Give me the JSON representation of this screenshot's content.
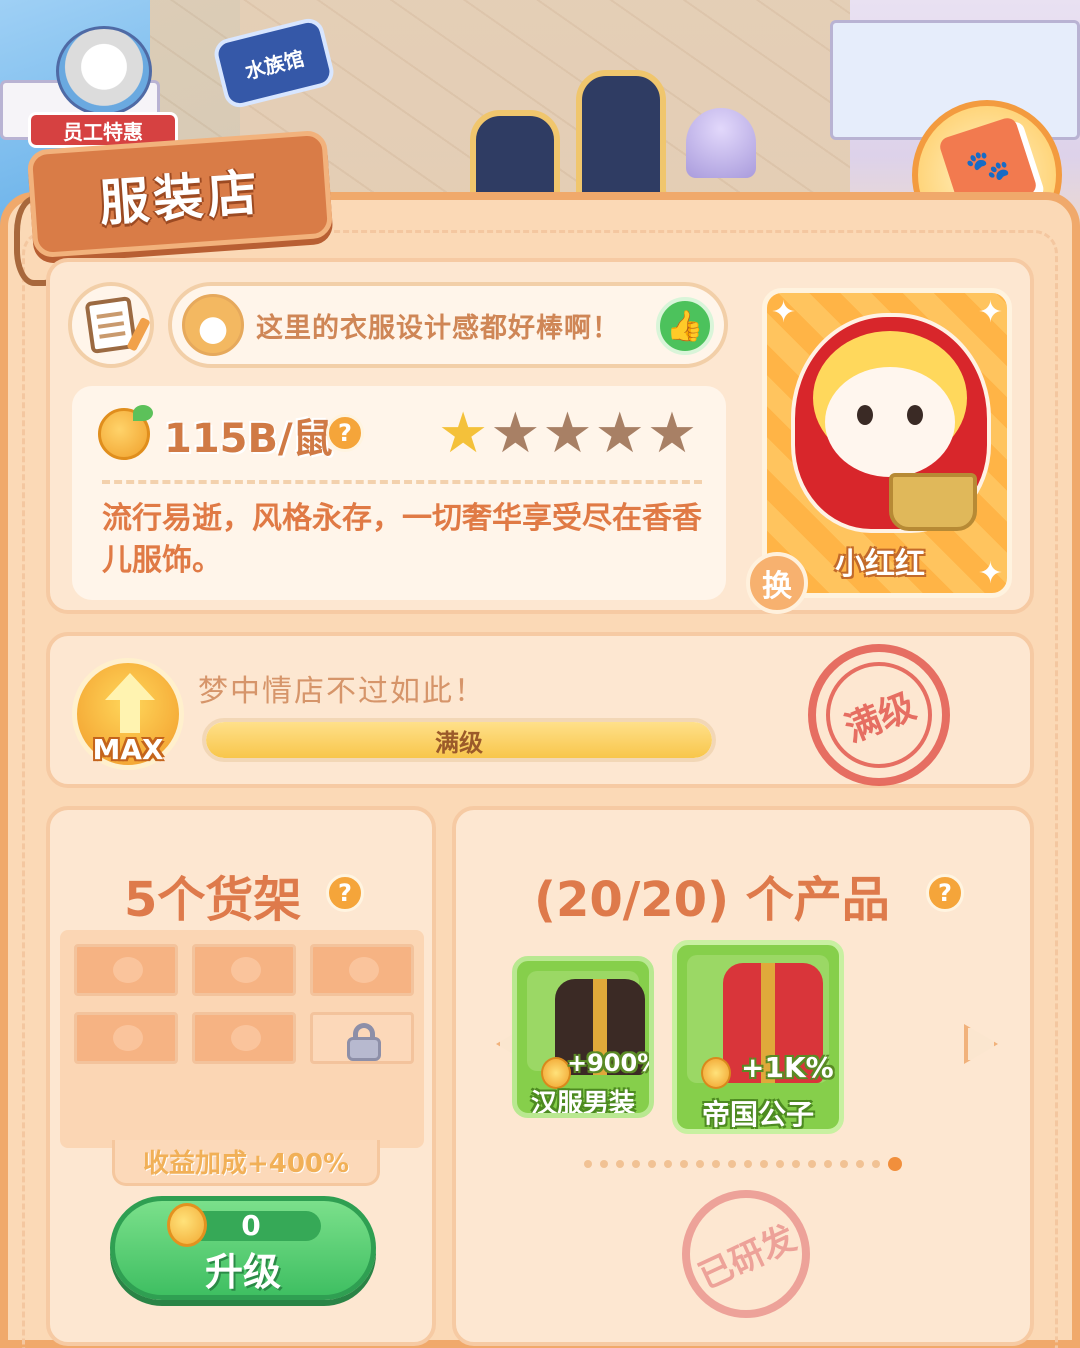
{
  "scene": {
    "aquarium_sign": "水族馆",
    "staff_badge": "员工特惠"
  },
  "shop": {
    "title": "服装店",
    "quote": "这里的衣服设计感都好棒啊！",
    "income": "115B/鼠",
    "stars_total": 5,
    "stars_filled": 1,
    "description": "流行易逝，风格永存，一切奢华享受尽在香香儿服饰。",
    "character_name": "小红红",
    "swap_label": "换"
  },
  "level": {
    "badge_text": "MAX",
    "tagline": "梦中情店不过如此！",
    "progress_label": "满级",
    "progress_fraction": 1.0,
    "stamp": "满级"
  },
  "shelves": {
    "title": "5个货架",
    "slots": 6,
    "unlocked": 5,
    "bonus": "收益加成+400%",
    "upgrade_cost": "0",
    "upgrade_label": "升级"
  },
  "products": {
    "title": "(20/20) 个产品",
    "items": [
      {
        "name": "汉服男装",
        "bonus": "+900%"
      },
      {
        "name": "帝国公子",
        "bonus": "+1K%"
      }
    ],
    "page_dots": 20,
    "active_dot": 20,
    "stamp": "已研发"
  },
  "colors": {
    "panel_bg": "#fbd9b6",
    "panel_border": "#f0a96b",
    "accent_text": "#de7a4b",
    "green_button": "#3fbf62",
    "stamp_red": "#e35a4f"
  }
}
